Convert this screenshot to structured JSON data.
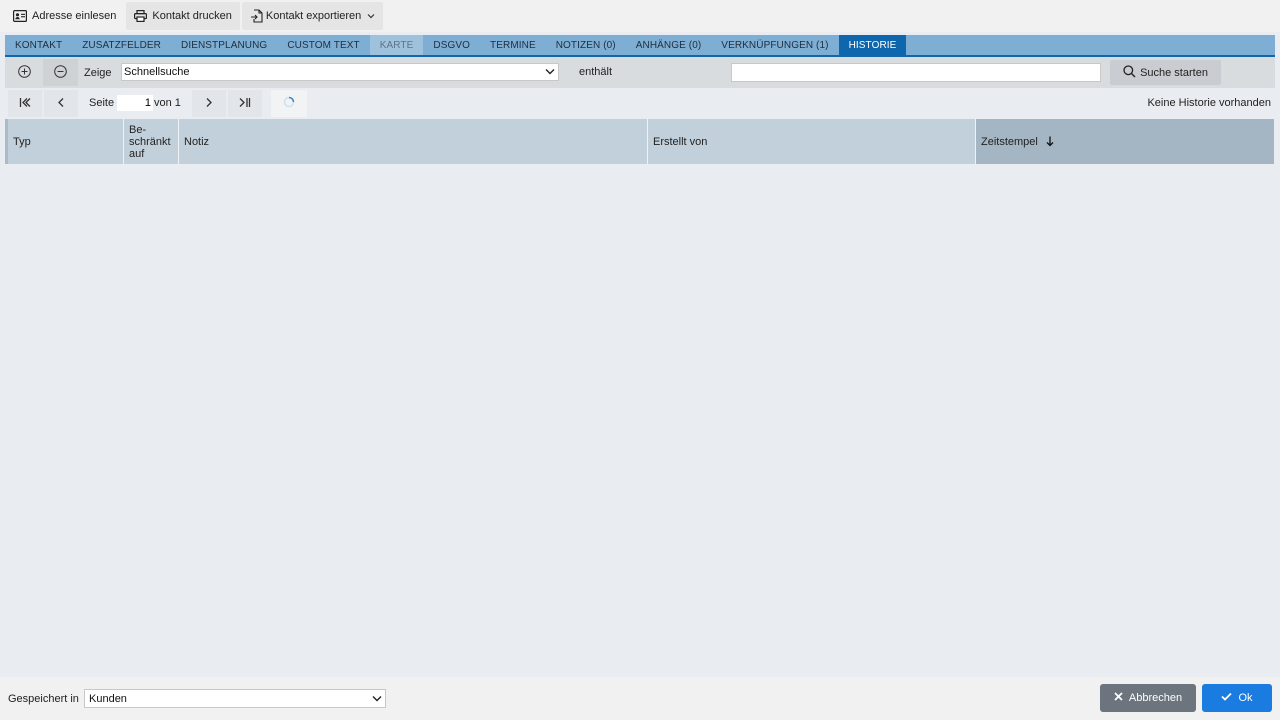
{
  "toolbar": {
    "read_address_label": "Adresse einlesen",
    "print_contact_label": "Kontakt drucken",
    "export_contact_label": "Kontakt exportieren"
  },
  "tabs": [
    {
      "label": "KONTAKT",
      "state": "normal"
    },
    {
      "label": "ZUSATZFELDER",
      "state": "normal"
    },
    {
      "label": "DIENSTPLANUNG",
      "state": "normal"
    },
    {
      "label": "CUSTOM TEXT",
      "state": "normal"
    },
    {
      "label": "KARTE",
      "state": "disabled"
    },
    {
      "label": "DSGVO",
      "state": "normal"
    },
    {
      "label": "TERMINE",
      "state": "normal"
    },
    {
      "label": "NOTIZEN (0)",
      "state": "normal"
    },
    {
      "label": "ANHÄNGE (0)",
      "state": "normal"
    },
    {
      "label": "VERKNÜPFUNGEN (1)",
      "state": "normal"
    },
    {
      "label": "HISTORIE",
      "state": "active"
    }
  ],
  "search": {
    "show_label": "Zeige",
    "field_value": "Schnellsuche",
    "operator_label": "enthält",
    "query_value": "",
    "button_label": "Suche starten"
  },
  "pagination": {
    "page_label": "Seite",
    "current_page": "1",
    "of_label": "von 1",
    "status": "Keine Historie vorhanden"
  },
  "grid": {
    "columns": [
      {
        "label": "Typ"
      },
      {
        "label": "Be-\nschränkt\nauf"
      },
      {
        "label": "Notiz"
      },
      {
        "label": "Erstellt von"
      },
      {
        "label": "Zeitstempel",
        "sort": "descending"
      }
    ],
    "rows": []
  },
  "footer": {
    "saved_in_label": "Gespeichert in",
    "saved_in_value": "Kunden",
    "cancel_label": "Abbrechen",
    "ok_label": "Ok"
  },
  "colors": {
    "accent": "#0e67ad",
    "ok_button": "#1a7be0",
    "cancel_button": "#6c747d",
    "tab_bar": "#7eaed3"
  }
}
